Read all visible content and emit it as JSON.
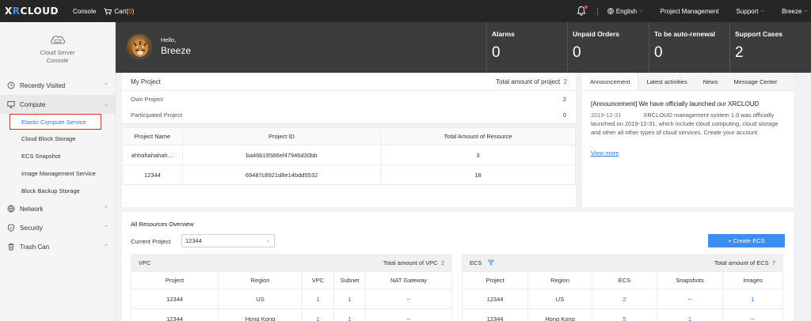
{
  "topbar": {
    "logo_a": "X",
    "logo_b": "R",
    "logo_c": "CLOUD",
    "console": "Console",
    "cart_label": "Cart(",
    "cart_count": "0",
    "cart_close": ")",
    "language": "English",
    "project_management": "Project Management",
    "support": "Support",
    "user": "Breeze"
  },
  "sidebar": {
    "title_line1": "Cloud Server",
    "title_line2": "Console",
    "sections": {
      "recent": "Recently Visited",
      "compute": "Compute",
      "network": "Network",
      "security": "Security",
      "trash": "Trash Can"
    },
    "compute_items": [
      "Elastic Compute Service",
      "Cloud Block Storage",
      "ECS Snapshot",
      "Image Management Service",
      "Block Backup Storage"
    ]
  },
  "hero": {
    "hello": "Hello,",
    "name": "Breeze",
    "stats": [
      {
        "label": "Alarms",
        "value": "0"
      },
      {
        "label": "Unpaid Orders",
        "value": "0"
      },
      {
        "label": "To be auto-renewal",
        "value": "0"
      },
      {
        "label": "Support Cases",
        "value": "2"
      }
    ]
  },
  "my_project": {
    "title": "My Project",
    "total_label": "Total amount of project",
    "total_value": "2",
    "own_label": "Own Project",
    "own_value": "2",
    "participated_label": "Participated Project",
    "participated_value": "0",
    "columns": [
      "Project Name",
      "Project ID",
      "Total Amount of Resource"
    ],
    "rows": [
      [
        "ahhahahahah…",
        "ba49b19586ef47946d30bb",
        "3"
      ],
      [
        "12344",
        "69487c8921d8e14bdd5532",
        "18"
      ]
    ]
  },
  "announcement": {
    "tabs": [
      "Announcement",
      "Latest activities",
      "News",
      "Message Center"
    ],
    "title": "[Announcement] We have officially launched our XRCLOUD",
    "date": "2019-12-31",
    "body": "XRCLOUD management system 1.0 was officially launched on 2019-12-31, which include cloud computing, cloud storage and other all other types of cloud services. Create your account",
    "view_more": "View more"
  },
  "overview": {
    "title": "All Resources Overview",
    "current_project_label": "Current Project",
    "current_project_value": "12344",
    "create_button": "+ Create ECS",
    "vpc": {
      "title": "VPC",
      "total_label": "Total amount of VPC",
      "total_value": "2",
      "columns": [
        "Project",
        "Region",
        "VPC",
        "Subnet",
        "NAT Gateway"
      ],
      "rows": [
        [
          "12344",
          "US",
          "1",
          "1",
          "--"
        ],
        [
          "12344",
          "Hong Kong",
          "1",
          "1",
          "--"
        ]
      ]
    },
    "ecs": {
      "title": "ECS",
      "total_label": "Total amount of ECS",
      "total_value": "7",
      "columns": [
        "Project",
        "Region",
        "ECS",
        "Snapshots",
        "Images"
      ],
      "rows": [
        [
          "12344",
          "US",
          "2",
          "--",
          "1"
        ],
        [
          "12344",
          "Hong Kong",
          "5",
          "1",
          "--"
        ]
      ]
    }
  },
  "colors": {
    "accent": "#3c8ef0",
    "topbar": "#262626",
    "hero": "#3c3c3c",
    "highlight_border": "#e02a2a"
  }
}
